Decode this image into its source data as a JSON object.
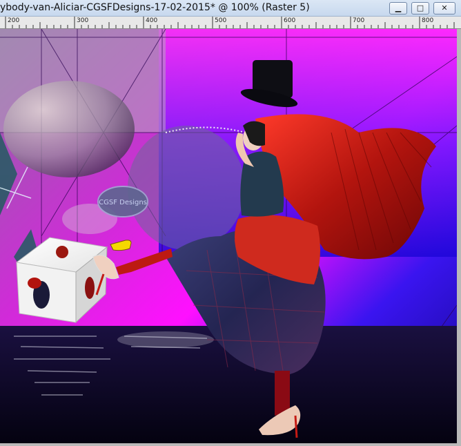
{
  "window": {
    "title": "ybody-van-Aliciar-CGSFDesigns-17-02-2015* @ 100% (Raster 5)",
    "buttons": {
      "minimize": "▁",
      "maximize": "□",
      "close": "✕"
    }
  },
  "ruler": {
    "labels": [
      "200",
      "300",
      "400",
      "500",
      "600",
      "700",
      "800"
    ]
  },
  "canvas": {
    "watermark": "CGSF Designs",
    "colors": {
      "magenta": "#ff00ff",
      "blue": "#2200ff",
      "dark": "#0a0620",
      "red": "#c41a14",
      "plaid": "#2a2f55"
    }
  }
}
